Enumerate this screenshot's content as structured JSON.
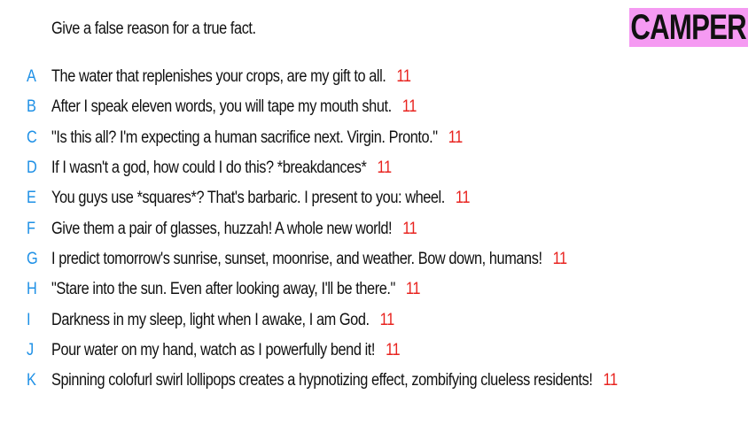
{
  "prompt": "Give a false reason for a true fact.",
  "team": "CAMPER",
  "colors": {
    "letter": "#1e90e6",
    "score": "#e8231f",
    "badge_bg": "#f59af2"
  },
  "answers": [
    {
      "letter": "A",
      "text": "The water that replenishes your crops, are my gift to all.",
      "score": "11"
    },
    {
      "letter": "B",
      "text": "After I speak eleven words, you will tape my mouth shut.",
      "score": "11"
    },
    {
      "letter": "C",
      "text": "\"Is this all? I'm expecting a human sacrifice next. Virgin. Pronto.\"",
      "score": "11"
    },
    {
      "letter": "D",
      "text": "If I wasn't a god, how could I do this? *breakdances*",
      "score": "11"
    },
    {
      "letter": "E",
      "text": "You guys use *squares*? That's barbaric. I present to you: wheel.",
      "score": "11"
    },
    {
      "letter": "F",
      "text": "Give them a pair of glasses, huzzah! A whole new world!",
      "score": "11"
    },
    {
      "letter": "G",
      "text": "I predict tomorrow's sunrise, sunset, moonrise, and weather. Bow down, humans!",
      "score": "11"
    },
    {
      "letter": "H",
      "text": "\"Stare into the sun. Even after looking away, I'll be there.\"",
      "score": "11"
    },
    {
      "letter": "I",
      "text": "Darkness in my sleep, light when I awake, I am God.",
      "score": "11"
    },
    {
      "letter": "J",
      "text": "Pour water on my hand, watch as I powerfully bend it!",
      "score": "11"
    },
    {
      "letter": "K",
      "text": "Spinning colofurl swirl lollipops creates a hypnotizing effect, zombifying clueless residents!",
      "score": "11"
    }
  ]
}
